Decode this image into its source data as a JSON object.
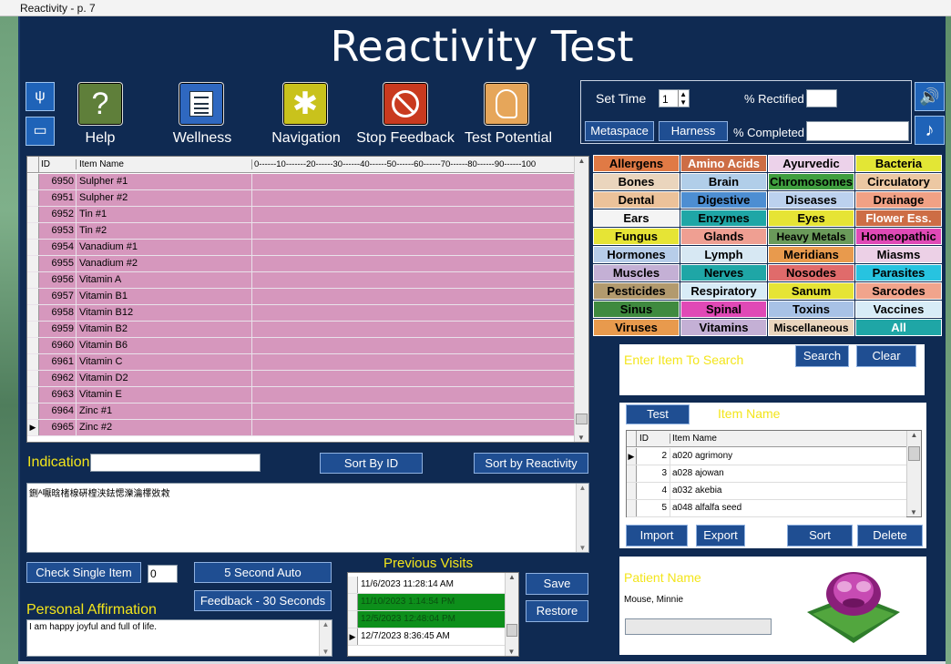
{
  "window_title": "Reactivity - p. 7",
  "app_title": "Reactivity Test",
  "toolbar": {
    "help": "Help",
    "wellness": "Wellness",
    "navigation": "Navigation",
    "stop_feedback": "Stop Feedback",
    "test_potential": "Test Potential"
  },
  "settings": {
    "set_time_label": "Set Time",
    "set_time_value": "1",
    "rectified_label": "% Rectified",
    "completed_label": "% Completed",
    "metaspace": "Metaspace",
    "harness": "Harness"
  },
  "item_grid": {
    "col_id": "ID",
    "col_name": "Item Name",
    "col_scale": "0------10-------20------30------40------50------60------70------80------90------100",
    "rows": [
      {
        "id": "6950",
        "name": "Sulpher #1"
      },
      {
        "id": "6951",
        "name": "Sulpher #2"
      },
      {
        "id": "6952",
        "name": "Tin #1"
      },
      {
        "id": "6953",
        "name": "Tin #2"
      },
      {
        "id": "6954",
        "name": "Vanadium #1"
      },
      {
        "id": "6955",
        "name": "Vanadium #2"
      },
      {
        "id": "6956",
        "name": "Vitamin A"
      },
      {
        "id": "6957",
        "name": "Vitamin B1"
      },
      {
        "id": "6958",
        "name": "Vitamin B12"
      },
      {
        "id": "6959",
        "name": "Vitamin B2"
      },
      {
        "id": "6960",
        "name": "Vitamin B6"
      },
      {
        "id": "6961",
        "name": "Vitamin C"
      },
      {
        "id": "6962",
        "name": "Vitamin D2"
      },
      {
        "id": "6963",
        "name": "Vitamin E"
      },
      {
        "id": "6964",
        "name": "Zinc #1"
      },
      {
        "id": "6965",
        "name": "Zinc #2"
      }
    ]
  },
  "indication_label": "Indication",
  "sort_by_id": "Sort By ID",
  "sort_by_reactivity": "Sort by Reactivity",
  "notes_text": "鉶ᴬ嚈晗楮楾硏楻浃鉣愢濼瀹檡敚敹",
  "check_single_item": "Check Single Item",
  "check_value": "0",
  "five_second_auto": "5 Second Auto",
  "feedback_30": "Feedback - 30 Seconds",
  "affirmation_label": "Personal Affirmation",
  "affirmation_text": "I am happy joyful and full of life.",
  "previous_visits_label": "Previous Visits",
  "visits": [
    {
      "date": "11/6/2023 11:28:14 AM",
      "hl": false
    },
    {
      "date": "11/10/2023 1:14:54 PM",
      "hl": true
    },
    {
      "date": "12/5/2023 12:48:04 PM",
      "hl": true
    },
    {
      "date": "12/7/2023 8:36:45 AM",
      "hl": false
    }
  ],
  "save": "Save",
  "restore": "Restore",
  "categories": [
    {
      "label": "Allergens",
      "bg": "#e07a45",
      "fg": "#000"
    },
    {
      "label": "Amino Acids",
      "bg": "#cd6d45",
      "fg": "#fff"
    },
    {
      "label": "Ayurvedic",
      "bg": "#ecd2ea",
      "fg": "#000"
    },
    {
      "label": "Bacteria",
      "bg": "#e3e635",
      "fg": "#000"
    },
    {
      "label": "Bones",
      "bg": "#ead5bd",
      "fg": "#000"
    },
    {
      "label": "Brain",
      "bg": "#b1cee9",
      "fg": "#000"
    },
    {
      "label": "Chromosomes",
      "bg": "#3f9e3f",
      "fg": "#000"
    },
    {
      "label": "Circulatory",
      "bg": "#ecc8a3",
      "fg": "#000"
    },
    {
      "label": "Dental",
      "bg": "#ecc29a",
      "fg": "#000"
    },
    {
      "label": "Digestive",
      "bg": "#4d8ed2",
      "fg": "#000"
    },
    {
      "label": "Diseases",
      "bg": "#bcd1ee",
      "fg": "#000"
    },
    {
      "label": "Drainage",
      "bg": "#f1a185",
      "fg": "#000"
    },
    {
      "label": "Ears",
      "bg": "#f4f4f4",
      "fg": "#000"
    },
    {
      "label": "Enzymes",
      "bg": "#1fa6a6",
      "fg": "#000"
    },
    {
      "label": "Eyes",
      "bg": "#e6e435",
      "fg": "#000"
    },
    {
      "label": "Flower Ess.",
      "bg": "#cd6d45",
      "fg": "#fff"
    },
    {
      "label": "Fungus",
      "bg": "#e6e435",
      "fg": "#000"
    },
    {
      "label": "Glands",
      "bg": "#ef9f92",
      "fg": "#000"
    },
    {
      "label": "Heavy Metals",
      "bg": "#6a9a5a",
      "fg": "#000"
    },
    {
      "label": "Homeopathic",
      "bg": "#e049b6",
      "fg": "#000"
    },
    {
      "label": "Hormones",
      "bg": "#b7cde9",
      "fg": "#000"
    },
    {
      "label": "Lymph",
      "bg": "#d7e8f3",
      "fg": "#000"
    },
    {
      "label": "Meridians",
      "bg": "#e89a4d",
      "fg": "#000"
    },
    {
      "label": "Miasms",
      "bg": "#ecd0e6",
      "fg": "#000"
    },
    {
      "label": "Muscles",
      "bg": "#c4b0d5",
      "fg": "#000"
    },
    {
      "label": "Nerves",
      "bg": "#1fa6a6",
      "fg": "#000"
    },
    {
      "label": "Nosodes",
      "bg": "#e06b6b",
      "fg": "#000"
    },
    {
      "label": "Parasites",
      "bg": "#27c3e0",
      "fg": "#000"
    },
    {
      "label": "Pesticides",
      "bg": "#b29a6e",
      "fg": "#000"
    },
    {
      "label": "Respiratory",
      "bg": "#d8ecf7",
      "fg": "#000"
    },
    {
      "label": "Sanum",
      "bg": "#e6e435",
      "fg": "#000"
    },
    {
      "label": "Sarcodes",
      "bg": "#f1a48c",
      "fg": "#000"
    },
    {
      "label": "Sinus",
      "bg": "#3f8a3f",
      "fg": "#000"
    },
    {
      "label": "Spinal",
      "bg": "#e049b6",
      "fg": "#000"
    },
    {
      "label": "Toxins",
      "bg": "#a8c2e6",
      "fg": "#000"
    },
    {
      "label": "Vaccines",
      "bg": "#d8ecf7",
      "fg": "#000"
    },
    {
      "label": "Viruses",
      "bg": "#e89a4d",
      "fg": "#000"
    },
    {
      "label": "Vitamins",
      "bg": "#c4b0d5",
      "fg": "#000"
    },
    {
      "label": "Miscellaneous",
      "bg": "#ead5bd",
      "fg": "#000"
    },
    {
      "label": "All",
      "bg": "#1fa6a6",
      "fg": "#fff"
    }
  ],
  "search": {
    "placeholder": "Enter Item To Search",
    "search_btn": "Search",
    "clear_btn": "Clear"
  },
  "selected": {
    "test_btn": "Test",
    "item_name_label": "Item Name",
    "col_id": "ID",
    "col_name": "Item Name",
    "rows": [
      {
        "id": "2",
        "name": "a020 agrimony"
      },
      {
        "id": "3",
        "name": "a028 ajowan"
      },
      {
        "id": "4",
        "name": "a032 akebia"
      },
      {
        "id": "5",
        "name": "a048 alfalfa seed"
      }
    ],
    "import": "Import",
    "export": "Export",
    "sort": "Sort",
    "delete": "Delete"
  },
  "patient": {
    "label": "Patient Name",
    "name": "Mouse, Minnie"
  }
}
